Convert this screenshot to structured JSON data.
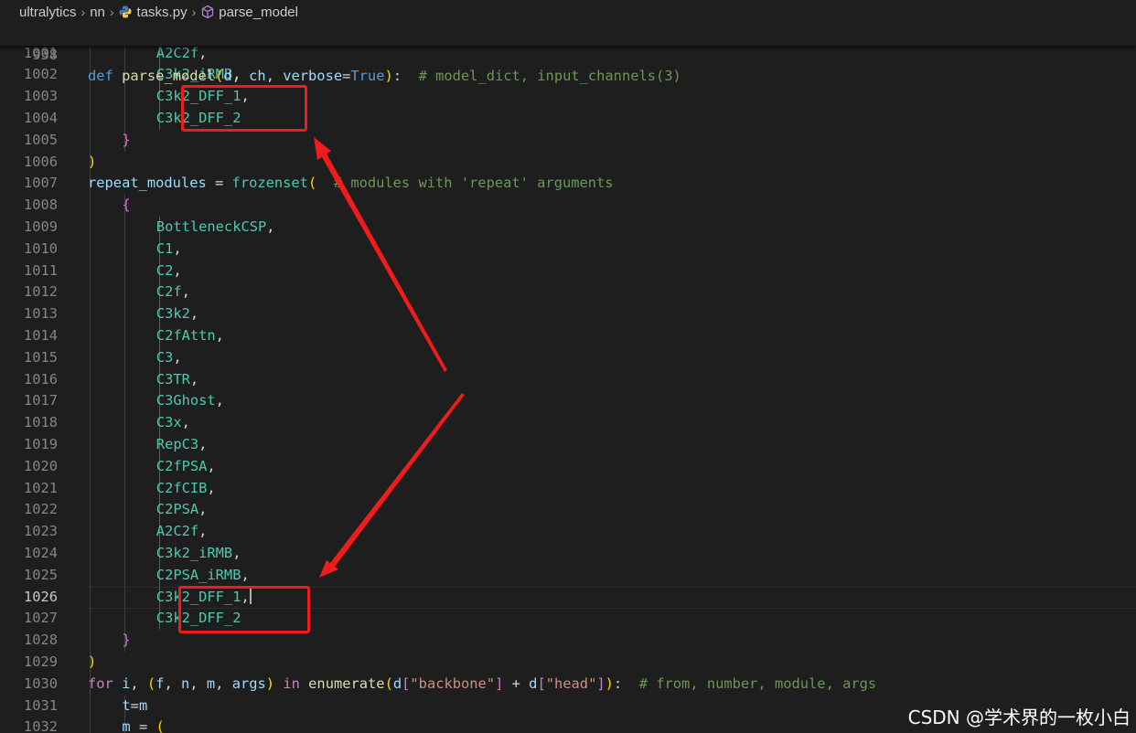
{
  "breadcrumb": [
    "ultralytics",
    "nn",
    "tasks.py",
    "parse_model"
  ],
  "sticky": {
    "line_number": "938",
    "tokens": [
      [
        "kw",
        "def"
      ],
      [
        "op",
        " "
      ],
      [
        "fn",
        "parse_model"
      ],
      [
        "b1",
        "("
      ],
      [
        "var",
        "d"
      ],
      [
        "op",
        ", "
      ],
      [
        "var",
        "ch"
      ],
      [
        "op",
        ", "
      ],
      [
        "var",
        "verbose"
      ],
      [
        "op",
        "="
      ],
      [
        "kw",
        "True"
      ],
      [
        "b1",
        ")"
      ],
      [
        "op",
        ":  "
      ],
      [
        "cm",
        "# model_dict, input_channels(3)"
      ]
    ]
  },
  "lines": [
    {
      "n": "1001",
      "indent": 3,
      "tokens": [
        [
          "cls",
          "A2C2f"
        ],
        [
          "op",
          ","
        ]
      ]
    },
    {
      "n": "1002",
      "indent": 3,
      "tokens": [
        [
          "cls",
          "C3k2_iRMB"
        ],
        [
          "op",
          ","
        ]
      ]
    },
    {
      "n": "1003",
      "indent": 3,
      "tokens": [
        [
          "cls",
          "C3k2_DFF_1"
        ],
        [
          "op",
          ","
        ]
      ]
    },
    {
      "n": "1004",
      "indent": 3,
      "tokens": [
        [
          "cls",
          "C3k2_DFF_2"
        ]
      ]
    },
    {
      "n": "1005",
      "indent": 2,
      "tokens": [
        [
          "b2",
          "}"
        ]
      ]
    },
    {
      "n": "1006",
      "indent": 1,
      "tokens": [
        [
          "b1",
          ")"
        ]
      ]
    },
    {
      "n": "1007",
      "indent": 1,
      "tokens": [
        [
          "var",
          "repeat_modules"
        ],
        [
          "op",
          " = "
        ],
        [
          "cls",
          "frozenset"
        ],
        [
          "b1",
          "("
        ],
        [
          "op",
          "  "
        ],
        [
          "cm",
          "# modules with 'repeat' arguments"
        ]
      ]
    },
    {
      "n": "1008",
      "indent": 2,
      "tokens": [
        [
          "b2",
          "{"
        ]
      ]
    },
    {
      "n": "1009",
      "indent": 3,
      "tokens": [
        [
          "cls",
          "BottleneckCSP"
        ],
        [
          "op",
          ","
        ]
      ]
    },
    {
      "n": "1010",
      "indent": 3,
      "tokens": [
        [
          "cls",
          "C1"
        ],
        [
          "op",
          ","
        ]
      ]
    },
    {
      "n": "1011",
      "indent": 3,
      "tokens": [
        [
          "cls",
          "C2"
        ],
        [
          "op",
          ","
        ]
      ]
    },
    {
      "n": "1012",
      "indent": 3,
      "tokens": [
        [
          "cls",
          "C2f"
        ],
        [
          "op",
          ","
        ]
      ]
    },
    {
      "n": "1013",
      "indent": 3,
      "tokens": [
        [
          "cls",
          "C3k2"
        ],
        [
          "op",
          ","
        ]
      ]
    },
    {
      "n": "1014",
      "indent": 3,
      "tokens": [
        [
          "cls",
          "C2fAttn"
        ],
        [
          "op",
          ","
        ]
      ]
    },
    {
      "n": "1015",
      "indent": 3,
      "tokens": [
        [
          "cls",
          "C3"
        ],
        [
          "op",
          ","
        ]
      ]
    },
    {
      "n": "1016",
      "indent": 3,
      "tokens": [
        [
          "cls",
          "C3TR"
        ],
        [
          "op",
          ","
        ]
      ]
    },
    {
      "n": "1017",
      "indent": 3,
      "tokens": [
        [
          "cls",
          "C3Ghost"
        ],
        [
          "op",
          ","
        ]
      ]
    },
    {
      "n": "1018",
      "indent": 3,
      "tokens": [
        [
          "cls",
          "C3x"
        ],
        [
          "op",
          ","
        ]
      ]
    },
    {
      "n": "1019",
      "indent": 3,
      "tokens": [
        [
          "cls",
          "RepC3"
        ],
        [
          "op",
          ","
        ]
      ]
    },
    {
      "n": "1020",
      "indent": 3,
      "tokens": [
        [
          "cls",
          "C2fPSA"
        ],
        [
          "op",
          ","
        ]
      ]
    },
    {
      "n": "1021",
      "indent": 3,
      "tokens": [
        [
          "cls",
          "C2fCIB"
        ],
        [
          "op",
          ","
        ]
      ]
    },
    {
      "n": "1022",
      "indent": 3,
      "tokens": [
        [
          "cls",
          "C2PSA"
        ],
        [
          "op",
          ","
        ]
      ]
    },
    {
      "n": "1023",
      "indent": 3,
      "tokens": [
        [
          "cls",
          "A2C2f"
        ],
        [
          "op",
          ","
        ]
      ]
    },
    {
      "n": "1024",
      "indent": 3,
      "tokens": [
        [
          "cls",
          "C3k2_iRMB"
        ],
        [
          "op",
          ","
        ]
      ]
    },
    {
      "n": "1025",
      "indent": 3,
      "tokens": [
        [
          "cls",
          "C2PSA_iRMB"
        ],
        [
          "op",
          ","
        ]
      ]
    },
    {
      "n": "1026",
      "indent": 3,
      "active": true,
      "tokens": [
        [
          "cls",
          "C3k2_DFF_1"
        ],
        [
          "op",
          ","
        ],
        [
          "caret",
          ""
        ]
      ]
    },
    {
      "n": "1027",
      "indent": 3,
      "tokens": [
        [
          "cls",
          "C3k2_DFF_2"
        ]
      ]
    },
    {
      "n": "1028",
      "indent": 2,
      "tokens": [
        [
          "b2",
          "}"
        ]
      ]
    },
    {
      "n": "1029",
      "indent": 1,
      "tokens": [
        [
          "b1",
          ")"
        ]
      ]
    },
    {
      "n": "1030",
      "indent": 1,
      "tokens": [
        [
          "ctl",
          "for"
        ],
        [
          "op",
          " "
        ],
        [
          "var",
          "i"
        ],
        [
          "op",
          ", "
        ],
        [
          "b1",
          "("
        ],
        [
          "var",
          "f"
        ],
        [
          "op",
          ", "
        ],
        [
          "var",
          "n"
        ],
        [
          "op",
          ", "
        ],
        [
          "var",
          "m"
        ],
        [
          "op",
          ", "
        ],
        [
          "var",
          "args"
        ],
        [
          "b1",
          ")"
        ],
        [
          "op",
          " "
        ],
        [
          "ctl",
          "in"
        ],
        [
          "op",
          " "
        ],
        [
          "fn",
          "enumerate"
        ],
        [
          "b1",
          "("
        ],
        [
          "var",
          "d"
        ],
        [
          "b2",
          "["
        ],
        [
          "str",
          "\"backbone\""
        ],
        [
          "b2",
          "]"
        ],
        [
          "op",
          " + "
        ],
        [
          "var",
          "d"
        ],
        [
          "b2",
          "["
        ],
        [
          "str",
          "\"head\""
        ],
        [
          "b2",
          "]"
        ],
        [
          "b1",
          ")"
        ],
        [
          "op",
          ":  "
        ],
        [
          "cm",
          "# from, number, module, args"
        ]
      ]
    },
    {
      "n": "1031",
      "indent": 2,
      "tokens": [
        [
          "var",
          "t"
        ],
        [
          "op",
          "="
        ],
        [
          "var",
          "m"
        ]
      ]
    },
    {
      "n": "1032",
      "indent": 2,
      "tokens": [
        [
          "var",
          "m"
        ],
        [
          "op",
          " = "
        ],
        [
          "b1",
          "("
        ]
      ]
    }
  ],
  "watermark": "CSDN @学术界的一枚小白"
}
